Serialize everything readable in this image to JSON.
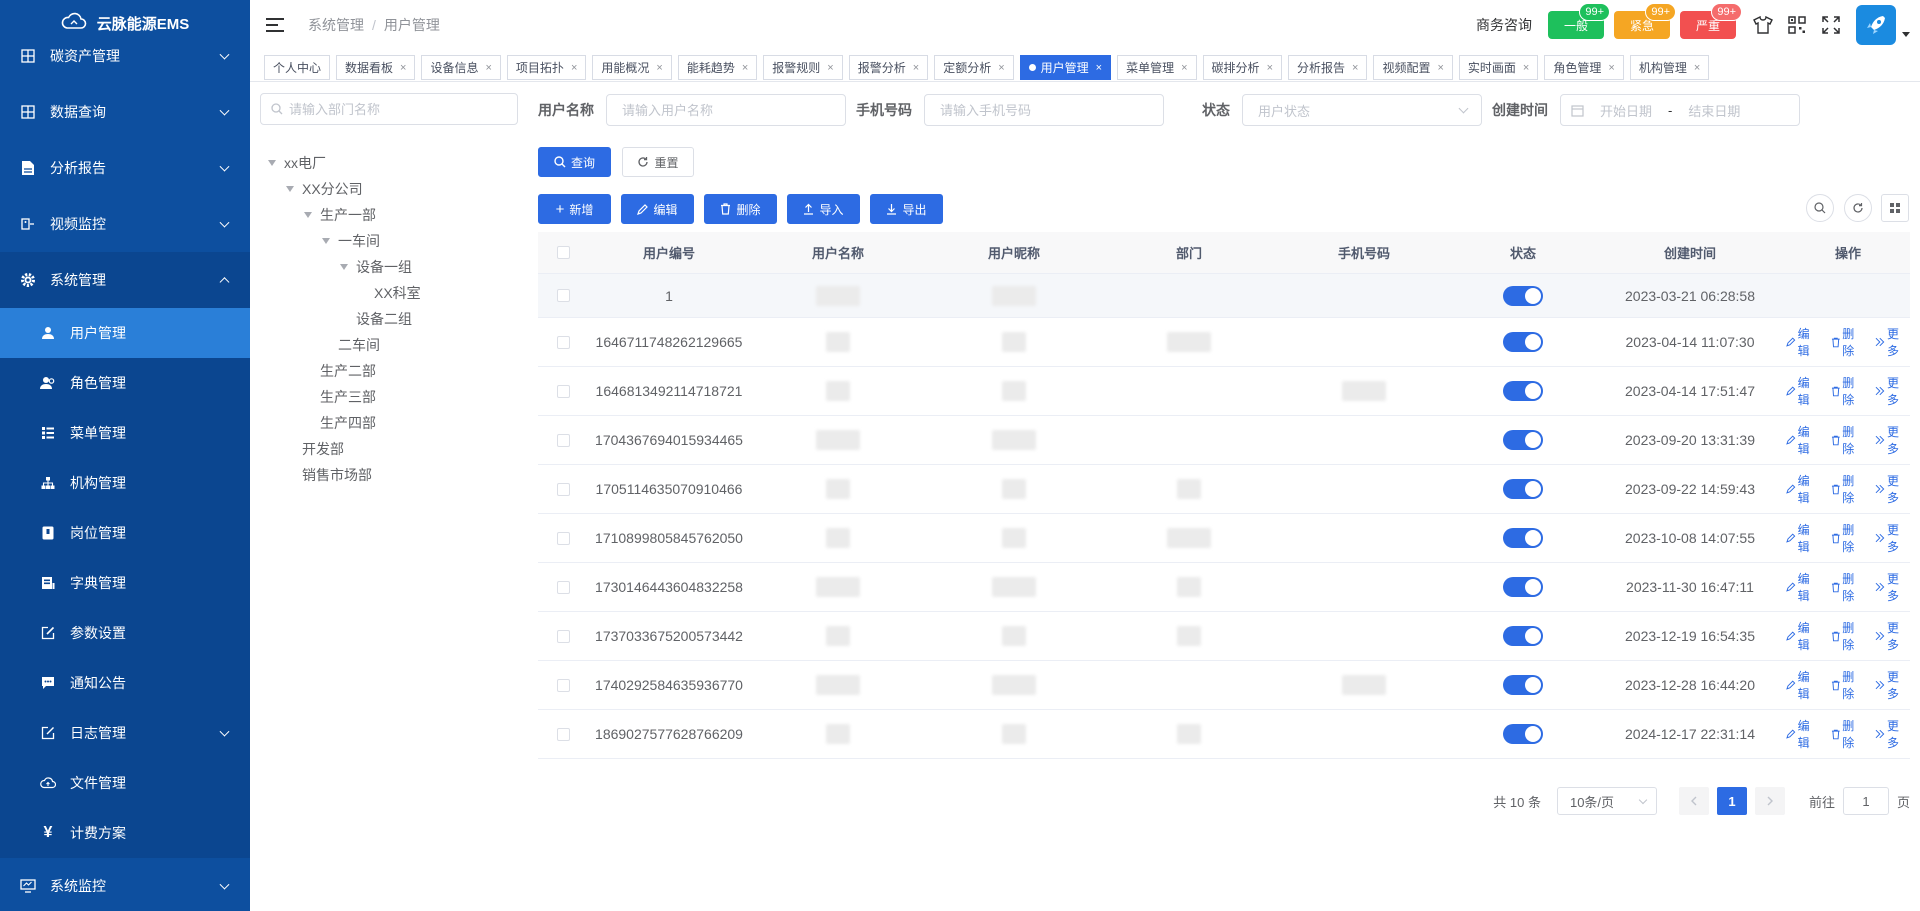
{
  "app": {
    "title": "云脉能源EMS"
  },
  "colors": {
    "sidebar": "#0d4f9f",
    "primary": "#2d6be3",
    "active_menu": "#2a7fd8",
    "green": "#1ec05c",
    "orange": "#f5a623",
    "red": "#f25050"
  },
  "sidebar": {
    "items_top": [
      {
        "label": "碳资产管理",
        "icon": "grid-icon"
      },
      {
        "label": "数据查询",
        "icon": "grid-icon"
      },
      {
        "label": "分析报告",
        "icon": "report-icon"
      },
      {
        "label": "视频监控",
        "icon": "video-icon"
      },
      {
        "label": "系统管理",
        "icon": "gear-icon"
      }
    ],
    "sub_items": [
      {
        "label": "用户管理",
        "icon": "user-icon"
      },
      {
        "label": "角色管理",
        "icon": "users-icon"
      },
      {
        "label": "菜单管理",
        "icon": "list-icon"
      },
      {
        "label": "机构管理",
        "icon": "org-icon"
      },
      {
        "label": "岗位管理",
        "icon": "badge-icon"
      },
      {
        "label": "字典管理",
        "icon": "book-icon"
      },
      {
        "label": "参数设置",
        "icon": "edit-icon"
      },
      {
        "label": "通知公告",
        "icon": "message-icon"
      },
      {
        "label": "日志管理",
        "icon": "log-icon"
      },
      {
        "label": "文件管理",
        "icon": "cloud-icon"
      },
      {
        "label": "计费方案",
        "icon": "yen-icon"
      }
    ],
    "items_bottom": [
      {
        "label": "系统监控",
        "icon": "monitor-icon"
      }
    ]
  },
  "header": {
    "breadcrumb": [
      "系统管理",
      "用户管理"
    ],
    "business": "商务咨询",
    "alarms": [
      {
        "label": "一般",
        "badge": "99+"
      },
      {
        "label": "紧急",
        "badge": "99+"
      },
      {
        "label": "严重",
        "badge": "99+"
      }
    ]
  },
  "tags": [
    "个人中心",
    "数据看板",
    "设备信息",
    "项目拓扑",
    "用能概况",
    "能耗趋势",
    "报警规则",
    "报警分析",
    "定额分析",
    "用户管理",
    "菜单管理",
    "碳排分析",
    "分析报告",
    "视频配置",
    "实时画面",
    "角色管理",
    "机构管理"
  ],
  "dept_search": {
    "placeholder": "请输入部门名称"
  },
  "tree": [
    {
      "label": "xx电厂",
      "level": 0,
      "expandable": true
    },
    {
      "label": "XX分公司",
      "level": 1,
      "expandable": true
    },
    {
      "label": "生产一部",
      "level": 2,
      "expandable": true
    },
    {
      "label": "一车间",
      "level": 3,
      "expandable": true
    },
    {
      "label": "设备一组",
      "level": 4,
      "expandable": true
    },
    {
      "label": "XX科室",
      "level": 5,
      "expandable": false
    },
    {
      "label": "设备二组",
      "level": 4,
      "expandable": false
    },
    {
      "label": "二车间",
      "level": 3,
      "expandable": false
    },
    {
      "label": "生产二部",
      "level": 2,
      "expandable": false
    },
    {
      "label": "生产三部",
      "level": 2,
      "expandable": false
    },
    {
      "label": "生产四部",
      "level": 2,
      "expandable": false
    },
    {
      "label": "开发部",
      "level": 1,
      "expandable": false
    },
    {
      "label": "销售市场部",
      "level": 1,
      "expandable": false
    }
  ],
  "search": {
    "username_label": "用户名称",
    "username_placeholder": "请输入用户名称",
    "phone_label": "手机号码",
    "phone_placeholder": "请输入手机号码",
    "status_label": "状态",
    "status_placeholder": "用户状态",
    "created_label": "创建时间",
    "start_placeholder": "开始日期",
    "date_sep": "-",
    "end_placeholder": "结束日期",
    "query": "查询",
    "reset": "重置"
  },
  "actions": {
    "add": "新增",
    "edit": "编辑",
    "delete": "删除",
    "import": "导入",
    "export": "导出"
  },
  "table": {
    "headers": [
      "用户编号",
      "用户名称",
      "用户昵称",
      "部门",
      "手机号码",
      "状态",
      "创建时间",
      "操作"
    ],
    "rows": [
      {
        "id": "1",
        "created": "2023-03-21 06:28:58",
        "has_ops": false
      },
      {
        "id": "1646711748262129665",
        "created": "2023-04-14 11:07:30",
        "has_ops": true
      },
      {
        "id": "1646813492114718721",
        "created": "2023-04-14 17:51:47",
        "has_ops": true
      },
      {
        "id": "1704367694015934465",
        "created": "2023-09-20 13:31:39",
        "has_ops": true
      },
      {
        "id": "1705114635070910466",
        "created": "2023-09-22 14:59:43",
        "has_ops": true
      },
      {
        "id": "1710899805845762050",
        "created": "2023-10-08 14:07:55",
        "has_ops": true
      },
      {
        "id": "1730146443604832258",
        "created": "2023-11-30 16:47:11",
        "has_ops": true
      },
      {
        "id": "1737033675200573442",
        "created": "2023-12-19 16:54:35",
        "has_ops": true
      },
      {
        "id": "1740292584635936770",
        "created": "2023-12-28 16:44:20",
        "has_ops": true
      },
      {
        "id": "1869027577628766209",
        "created": "2024-12-17 22:31:14",
        "has_ops": true
      }
    ],
    "op_edit": "编辑",
    "op_delete": "删除",
    "op_more": "更多"
  },
  "pagination": {
    "total_text": "共 10 条",
    "page_size": "10条/页",
    "current": "1",
    "goto_label": "前往",
    "goto_value": "1",
    "page_unit": "页"
  }
}
